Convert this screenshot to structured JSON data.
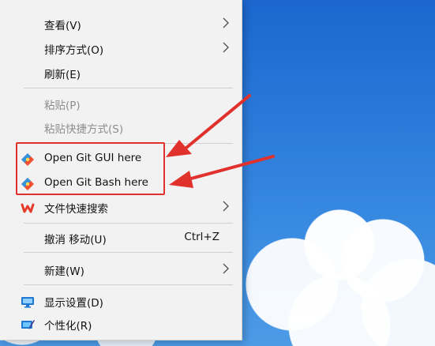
{
  "menu": {
    "items": [
      {
        "label": "查看(V)",
        "has_submenu": true,
        "disabled": false
      },
      {
        "label": "排序方式(O)",
        "has_submenu": true,
        "disabled": false
      },
      {
        "label": "刷新(E)",
        "has_submenu": false,
        "disabled": false
      },
      {
        "label": "粘贴(P)",
        "has_submenu": false,
        "disabled": true
      },
      {
        "label": "粘贴快捷方式(S)",
        "has_submenu": false,
        "disabled": true
      },
      {
        "label": "Open Git GUI here",
        "has_submenu": false,
        "disabled": false,
        "icon": "git-icon"
      },
      {
        "label": "Open Git Bash here",
        "has_submenu": false,
        "disabled": false,
        "icon": "git-icon"
      },
      {
        "label": "文件快速搜索",
        "has_submenu": true,
        "disabled": false,
        "icon": "wps-icon"
      },
      {
        "label": "撤消 移动(U)",
        "shortcut": "Ctrl+Z",
        "has_submenu": false,
        "disabled": false
      },
      {
        "label": "新建(W)",
        "has_submenu": true,
        "disabled": false
      },
      {
        "label": "显示设置(D)",
        "has_submenu": false,
        "disabled": false,
        "icon": "display-settings-icon"
      },
      {
        "label": "个性化(R)",
        "has_submenu": false,
        "disabled": false,
        "icon": "personalize-icon"
      }
    ]
  },
  "colors": {
    "annotation_red": "#e0312c",
    "menu_bg": "#f2f2f2",
    "disabled_text": "#8d8d8d"
  }
}
